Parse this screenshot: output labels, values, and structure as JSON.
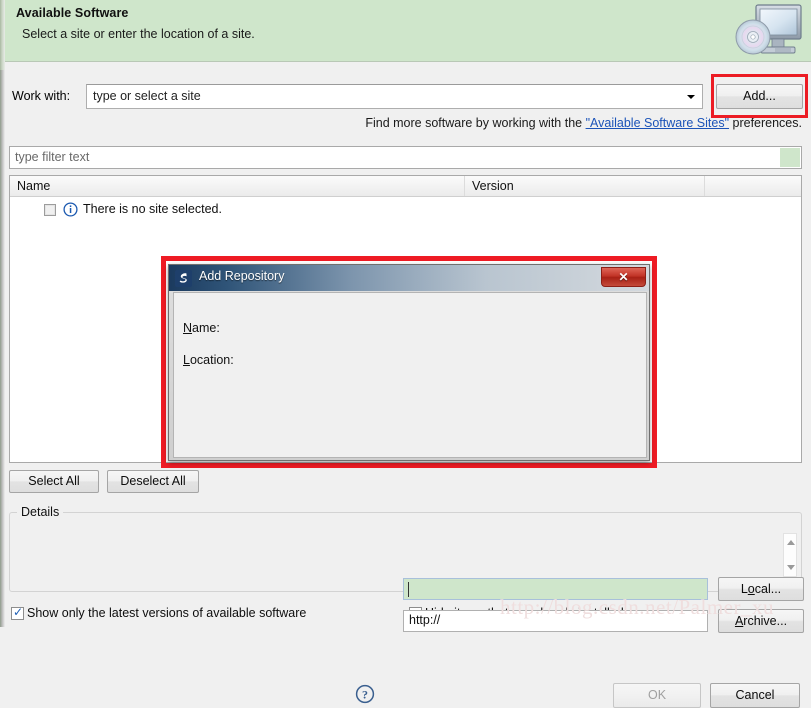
{
  "banner": {
    "title": "Available Software",
    "subtitle": "Select a site or enter the location of a site.",
    "icon": "computer-with-disc-icon",
    "bg_color": "#cfe6cb"
  },
  "work_with": {
    "label": "Work with:",
    "value": "",
    "placeholder": "type or select a site",
    "dropdown_icon": "chevron-down-icon"
  },
  "add_button": {
    "label": "Add...",
    "highlight_color": "#ec1c24"
  },
  "find_more": {
    "prefix": "Find more software by working with the ",
    "link": "\"Available Software Sites\"",
    "suffix": " preferences."
  },
  "filter": {
    "value": "",
    "placeholder": "type filter text"
  },
  "table": {
    "columns": [
      "Name",
      "Version",
      ""
    ],
    "rows": [
      {
        "checked": false,
        "icon": "info-icon",
        "name": "There is no site selected.",
        "version": ""
      }
    ]
  },
  "select_buttons": {
    "select_all": "Select All",
    "deselect_all": "Deselect All"
  },
  "details": {
    "legend": "Details",
    "content": "",
    "scroll_up_icon": "scroll-up-arrow-icon",
    "scroll_down_icon": "scroll-down-arrow-icon"
  },
  "bottom_options": [
    {
      "label": "Show only the latest versions of available software",
      "checked": true
    },
    {
      "label": "Hide items that are already installed",
      "checked": false
    }
  ],
  "watermark": "http://blog.csdn.net/Palmer_xu",
  "dialog": {
    "title": "Add Repository",
    "title_icon": "eclipse-icon",
    "close_label": "✕",
    "highlight_color": "#ee1b24",
    "name_field": {
      "label": "Name:",
      "mnemonic": "N",
      "rest": "ame:",
      "value": "",
      "focused": true
    },
    "location_field": {
      "label": "Location:",
      "mnemonic": "L",
      "rest": "ocation:",
      "value": "http://"
    },
    "local_button": {
      "pre": "L",
      "mn": "o",
      "post": "cal..."
    },
    "archive_button": {
      "pre": "",
      "mn": "A",
      "post": "rchive..."
    },
    "help_icon": "help-question-icon",
    "ok_button": {
      "label": "OK",
      "enabled": false
    },
    "cancel_button": {
      "label": "Cancel",
      "enabled": true
    }
  }
}
